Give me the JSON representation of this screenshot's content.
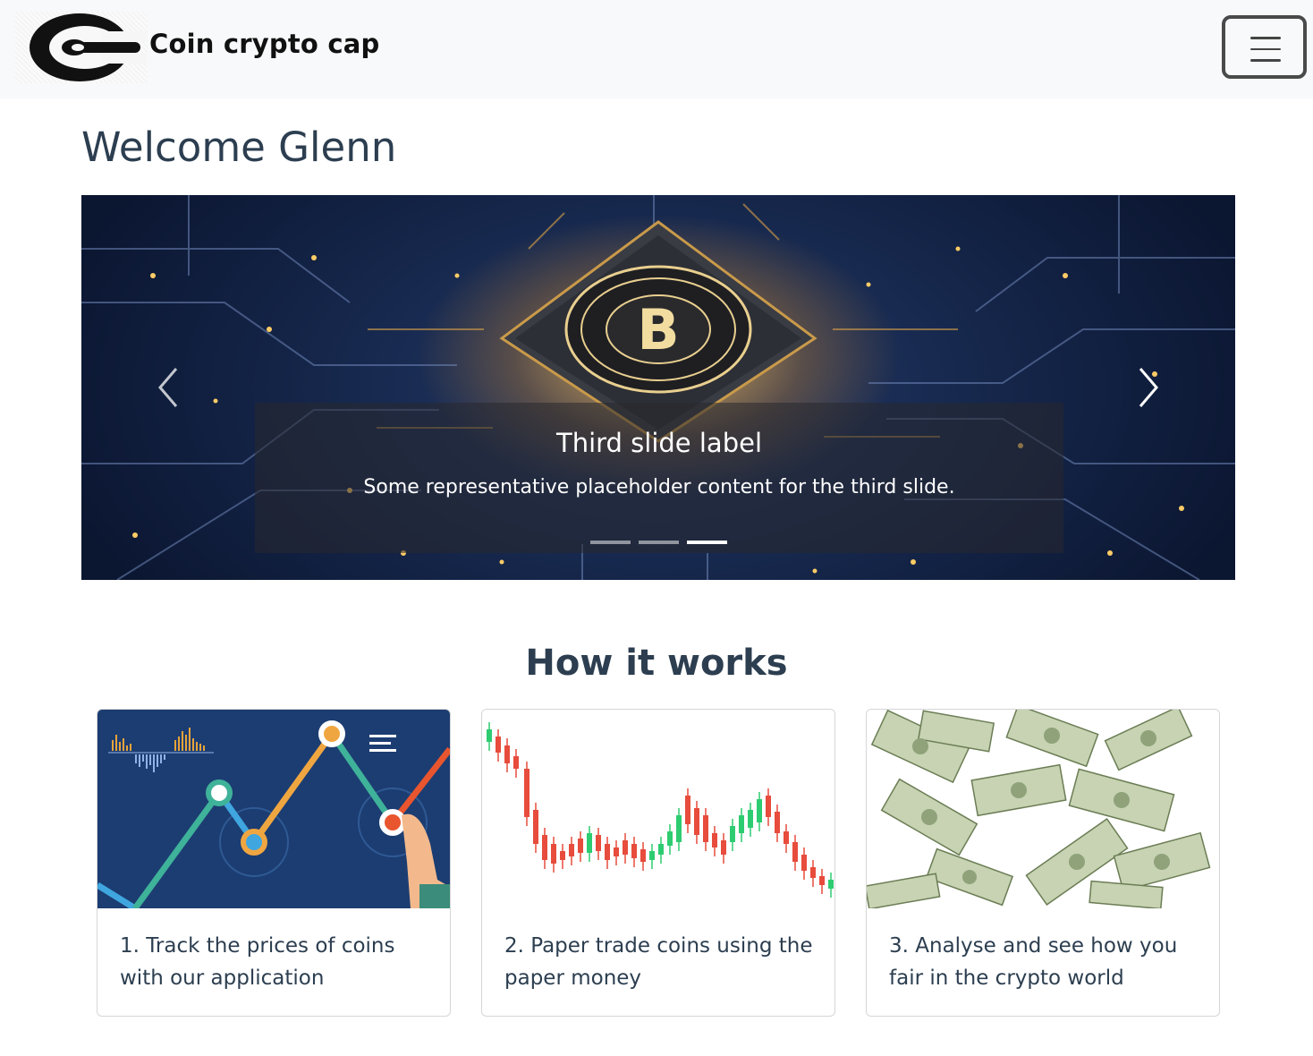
{
  "navbar": {
    "brand_name": "Coin crypto cap",
    "logo_icon": "coin-c-logo",
    "toggler_icon": "hamburger-menu-icon"
  },
  "welcome": "Welcome Glenn",
  "carousel": {
    "slide_image": "bitcoin-chip-circuit-board",
    "caption_title": "Third slide label",
    "caption_text": "Some representative placeholder content for the third slide.",
    "slide_count": 3,
    "active_slide": 3,
    "prev_icon": "chevron-left-icon",
    "next_icon": "chevron-right-icon"
  },
  "how_it_works": {
    "title": "How it works",
    "cards": [
      {
        "image": "growth-line-chart-illustration",
        "text": "1. Track the prices of coins with our application"
      },
      {
        "image": "candlestick-chart",
        "text": "2. Paper trade coins using the paper money"
      },
      {
        "image": "falling-dollar-bills",
        "text": "3. Analyse and see how you fair in the crypto world"
      }
    ]
  },
  "colors": {
    "navbar_bg": "#f8f9fa",
    "heading": "#2c3e50",
    "card2_up_candle": "#2ecc71",
    "card2_down_candle": "#e74c3c",
    "card1_bg": "#1c3d72"
  }
}
